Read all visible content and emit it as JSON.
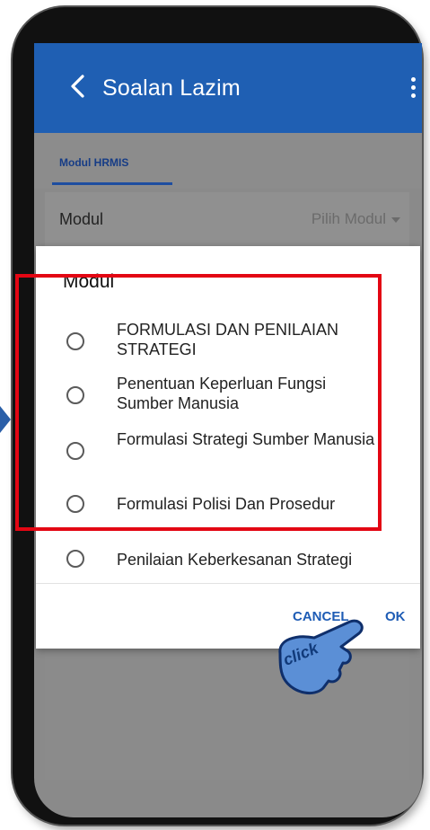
{
  "appbar": {
    "title": "Soalan Lazim"
  },
  "tabs": [
    {
      "label": "Modul HRMIS",
      "active": true
    }
  ],
  "modul_field": {
    "label": "Modul",
    "placeholder": "Pilih Modul"
  },
  "dialog": {
    "title": "Modul",
    "options": [
      {
        "label": "FORMULASI DAN PENILAIAN STRATEGI",
        "selected": false
      },
      {
        "label": "Penentuan Keperluan Fungsi Sumber Manusia",
        "selected": false
      },
      {
        "label": "Formulasi Strategi Sumber Manusia",
        "selected": false
      },
      {
        "label": "Formulasi Polisi Dan Prosedur",
        "selected": false
      },
      {
        "label": "Penilaian Keberkesanan Strategi",
        "selected": false
      }
    ],
    "cancel_label": "CANCEL",
    "ok_label": "OK"
  },
  "annotation": {
    "hand_label": "click",
    "highlight_color": "#e30613"
  },
  "colors": {
    "appbar": "#1f5fb3",
    "accent": "#1e5cb5"
  }
}
